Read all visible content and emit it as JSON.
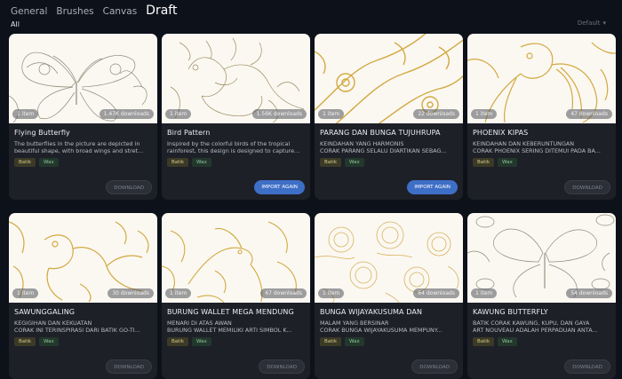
{
  "tabs": [
    "General",
    "Brushes",
    "Canvas",
    "Draft"
  ],
  "active_tab": "Draft",
  "filter": "All",
  "sort": "Default",
  "cards": [
    {
      "title": "Flying Butterfly",
      "desc": "The butterflies in the picture are depicted in beautiful shape, with broad wings and stret...",
      "items": "1 item",
      "downloads": "1.47K downloads",
      "tags": [
        "Batik",
        "Wax"
      ],
      "button": "DOWNLOAD",
      "button_type": "download",
      "motif": "butterfly"
    },
    {
      "title": "Bird Pattern",
      "desc": "Inspired by the colorful birds of the tropical rainforest, this design is designed to capture...",
      "items": "1 item",
      "downloads": "1.56K downloads",
      "tags": [
        "Batik",
        "Wax"
      ],
      "button": "IMPORT AGAIN",
      "button_type": "import",
      "motif": "bird"
    },
    {
      "title": "PARANG DAN BUNGA TUJUHRUPA",
      "desc": "KEINDAHAN YANG HARMONIS\nCORAK PARANG SELALU DIARTIKAN SEBAG...",
      "items": "1 item",
      "downloads": "22 downloads",
      "tags": [
        "Batik",
        "Wax"
      ],
      "button": "IMPORT AGAIN",
      "button_type": "import",
      "motif": "parang"
    },
    {
      "title": "PHOENIX KIPAS",
      "desc": "KEINDAHAN DAN KEBERUNTUNGAN\nCORAK PHOENIX SERING DITEMUI PADA BA...",
      "items": "1 item",
      "downloads": "47 downloads",
      "tags": [
        "Batik",
        "Wax"
      ],
      "button": "DOWNLOAD",
      "button_type": "download",
      "motif": "phoenix"
    },
    {
      "title": "SAWUNGGALING",
      "desc": "KEGIGIHAN DAN KEKUATAN\nCORAK INI TERINSPIRASI DARI BATIK GO-TI...",
      "items": "1 item",
      "downloads": "30 downloads",
      "tags": [
        "Batik",
        "Wax"
      ],
      "button": "DOWNLOAD",
      "button_type": "download",
      "motif": "rooster"
    },
    {
      "title": "BURUNG WALLET MEGA MENDUNG",
      "desc": "MENARI DI ATAS AWAN\nBURUNG WALLET MEMILIKI ARTI SIMBOL K...",
      "items": "1 item",
      "downloads": "67 downloads",
      "tags": [
        "Batik",
        "Wax"
      ],
      "button": "DOWNLOAD",
      "button_type": "download",
      "motif": "swallow"
    },
    {
      "title": "BUNGA WIJAYAKUSUMA DAN",
      "desc": "MALAM YANG BERSINAR\nCORAK BUNGA WIJAYAKUSUMA MEMPUNY...",
      "items": "1 item",
      "downloads": "64 downloads",
      "tags": [
        "Batik",
        "Wax"
      ],
      "button": "DOWNLOAD",
      "button_type": "download",
      "motif": "flower"
    },
    {
      "title": "KAWUNG BUTTERFLY",
      "desc": "BATIK CORAK KAWUNG, KUPU, DAN GAYA\nART NOUVEAU ADALAH PERPADUAN ANTA...",
      "items": "1 item",
      "downloads": "54 downloads",
      "tags": [
        "Batik",
        "Wax"
      ],
      "button": "DOWNLOAD",
      "button_type": "download",
      "motif": "kawung"
    }
  ],
  "colors": {
    "background": "#0d1119",
    "card": "#1e2028",
    "gold": "#d2a93f",
    "import_button": "#3e6fc7"
  }
}
